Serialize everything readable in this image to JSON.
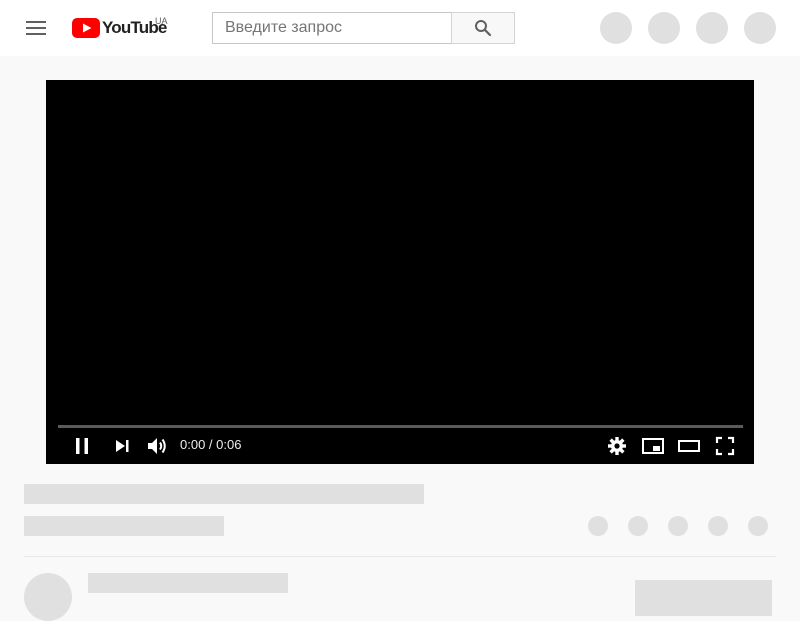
{
  "app": {
    "logo_text": "YouTube",
    "country_code": "UA",
    "brand_color": "#ff0000"
  },
  "search": {
    "placeholder": "Введите запрос",
    "value": ""
  },
  "icons": {
    "menu": "hamburger-menu-icon",
    "search": "search-icon",
    "pause": "pause-icon",
    "next": "next-icon",
    "volume": "volume-icon",
    "settings": "gear-icon",
    "miniplayer": "miniplayer-icon",
    "theater": "theater-mode-icon",
    "fullscreen": "fullscreen-icon"
  },
  "player": {
    "current_time": "0:00",
    "duration": "0:06",
    "time_display": "0:00 / 0:06",
    "progress_fraction": 0
  },
  "colors": {
    "placeholder_gray": "#e0e0e0",
    "page_bg": "#f9f9f9",
    "player_bg": "#000000"
  }
}
